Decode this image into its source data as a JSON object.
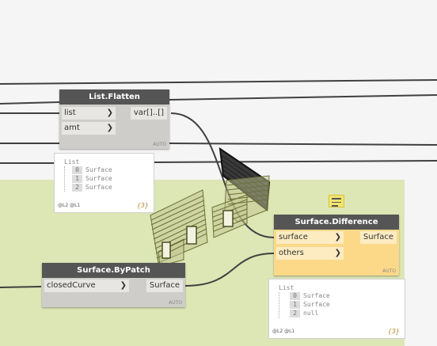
{
  "nodes": {
    "list_flatten": {
      "title": "List.Flatten",
      "inputs": [
        {
          "label": "list"
        },
        {
          "label": "amt"
        }
      ],
      "output": "var[]..[]",
      "lacing": "AUTO"
    },
    "surface_difference": {
      "title": "Surface.Difference",
      "inputs": [
        {
          "label": "surface"
        },
        {
          "label": "others"
        }
      ],
      "output": "Surface",
      "lacing": "AUTO"
    },
    "surface_bypatch": {
      "title": "Surface.ByPatch",
      "inputs": [
        {
          "label": "closedCurve"
        }
      ],
      "output": "Surface",
      "lacing": "AUTO"
    }
  },
  "previews": {
    "flatten_preview": {
      "header": "List",
      "items": [
        {
          "index": "0",
          "value": "Surface"
        },
        {
          "index": "1",
          "value": "Surface"
        },
        {
          "index": "2",
          "value": "Surface"
        }
      ],
      "levels": "@L2 @L1",
      "count": "{3}"
    },
    "difference_preview": {
      "header": "List",
      "items": [
        {
          "index": "0",
          "value": "Surface"
        },
        {
          "index": "1",
          "value": "Surface"
        },
        {
          "index": "2",
          "value": "null"
        }
      ],
      "levels": "@L2 @L1",
      "count": "{3}"
    }
  },
  "colors": {
    "group_background": "#dde6b5",
    "node_header": "#555555",
    "node_body": "#cfcdc9",
    "selected_body": "#fbd989",
    "wire": "#404040",
    "geometry": "#6b7134"
  }
}
